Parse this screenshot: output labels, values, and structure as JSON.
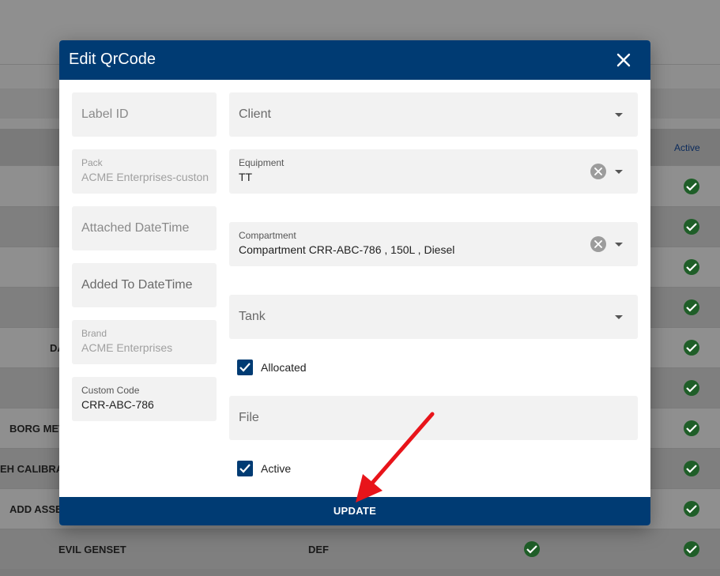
{
  "background": {
    "header_active": "Active",
    "rows": [
      {
        "left_text": "",
        "mid_text": ""
      },
      {
        "left_text": "",
        "mid_text": ""
      },
      {
        "left_text": "",
        "mid_text": ""
      },
      {
        "left_text": "",
        "mid_text": ""
      },
      {
        "left_text": "DA",
        "mid_text": ""
      },
      {
        "left_text": "",
        "mid_text": ""
      },
      {
        "left_text": "BORG MET",
        "mid_text": ""
      },
      {
        "left_text": "EH CALIBRA",
        "mid_text": ""
      },
      {
        "left_text": "ADD ASSE",
        "mid_text": ""
      },
      {
        "left_text": "EVIL GENSET",
        "mid_text": "DEF"
      }
    ]
  },
  "dialog": {
    "title": "Edit QrCode",
    "left_fields": {
      "label_id": {
        "placeholder": "Label ID"
      },
      "pack": {
        "label": "Pack",
        "value": "ACME Enterprises-custon"
      },
      "attached_datetime": {
        "placeholder": "Attached DateTime"
      },
      "added_to_datetime": {
        "placeholder": "Added To DateTime"
      },
      "brand": {
        "label": "Brand",
        "value": "ACME Enterprises"
      },
      "custom_code": {
        "label": "Custom Code",
        "value": "CRR-ABC-786"
      }
    },
    "right_fields": {
      "client": {
        "placeholder": "Client"
      },
      "equipment": {
        "label": "Equipment",
        "value": "TT"
      },
      "compartment": {
        "label": "Compartment",
        "value": "Compartment CRR-ABC-786 , 150L , Diesel"
      },
      "tank": {
        "placeholder": "Tank"
      },
      "allocated": {
        "label": "Allocated",
        "checked": true
      },
      "file": {
        "placeholder": "File"
      },
      "active": {
        "label": "Active",
        "checked": true
      }
    },
    "update_label": "UPDATE"
  },
  "colors": {
    "primary": "#003b73",
    "annotation_arrow": "#e8141a",
    "check_green": "#1f5e28"
  },
  "icons": [
    "close-icon",
    "chevron-down-icon",
    "clear-icon",
    "checkbox-checked-icon",
    "check-circle-icon",
    "annotation-arrow"
  ]
}
